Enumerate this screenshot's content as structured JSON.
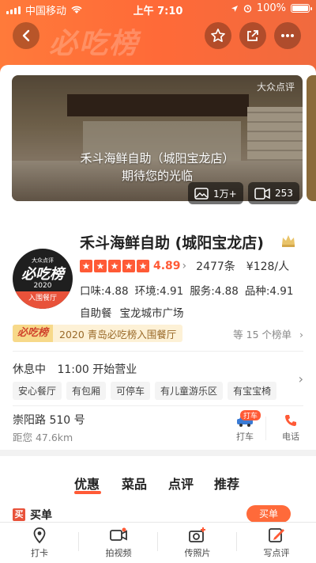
{
  "status_bar": {
    "carrier": "中国移动",
    "time": "上午 7:10",
    "battery": "100%"
  },
  "nav": {
    "title_watermark": "必吃榜"
  },
  "hero": {
    "watermark": "大众点评",
    "caption_line1": "禾斗海鲜自助（城阳宝龙店）",
    "caption_line2": "期待您的光临",
    "photos_count": "1万+",
    "videos_count": "253"
  },
  "logo": {
    "top": "大众点评",
    "main": "必吃榜",
    "year": "2020",
    "band": "入围餐厅"
  },
  "shop": {
    "name": "禾斗海鲜自助 (城阳宝龙店)",
    "score": "4.89",
    "reviews": "2477条",
    "price": "¥128/人",
    "sub_scores": [
      "口味:4.88",
      "环境:4.91",
      "服务:4.88",
      "品种:4.91"
    ],
    "categories": [
      "自助餐",
      "宝龙城市广场"
    ]
  },
  "rank": {
    "tag": "必吃榜",
    "text": "2020 青岛必吃榜入围餐厅",
    "more": "等 15 个榜单"
  },
  "hours": {
    "status": "休息中",
    "open_text": "11:00 开始营业"
  },
  "facility_tags": [
    "安心餐厅",
    "有包厢",
    "可停车",
    "有儿童游乐区",
    "有宝宝椅"
  ],
  "address": {
    "street": "崇阳路 510 号",
    "distance": "距您 47.6km",
    "taxi_label": "打车",
    "taxi_badge": "打车",
    "phone_label": "电话"
  },
  "tabs": [
    "优惠",
    "菜品",
    "点评",
    "推荐"
  ],
  "buy": {
    "icon": "买",
    "label": "买单",
    "button": "买单"
  },
  "bottom_bar": [
    "打卡",
    "拍视频",
    "传照片",
    "写点评"
  ],
  "colors": {
    "brand": "#ff6a38",
    "accent": "#ff5a36"
  }
}
